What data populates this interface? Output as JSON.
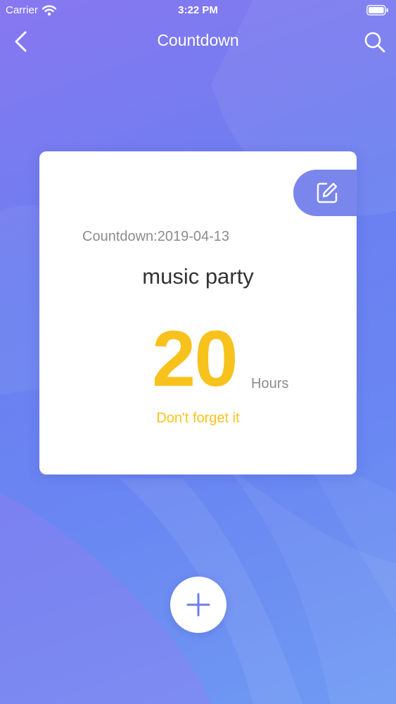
{
  "status_bar": {
    "carrier": "Carrier",
    "time": "3:22 PM",
    "icons": [
      "wifi-icon",
      "battery-icon"
    ]
  },
  "nav": {
    "title": "Countdown",
    "back_icon": "chevron-left-icon",
    "search_icon": "search-icon"
  },
  "card": {
    "date_label": "Countdown:2019-04-13",
    "event_title": "music party",
    "count_value": "20",
    "count_unit": "Hours",
    "reminder": "Don't forget it",
    "edit_icon": "edit-icon"
  },
  "add_button": {
    "icon": "plus-icon"
  },
  "colors": {
    "accent_yellow": "#f8c21c",
    "edit_button": "#7b86ec",
    "background_start": "#8877f0",
    "background_end": "#6f9af3"
  }
}
